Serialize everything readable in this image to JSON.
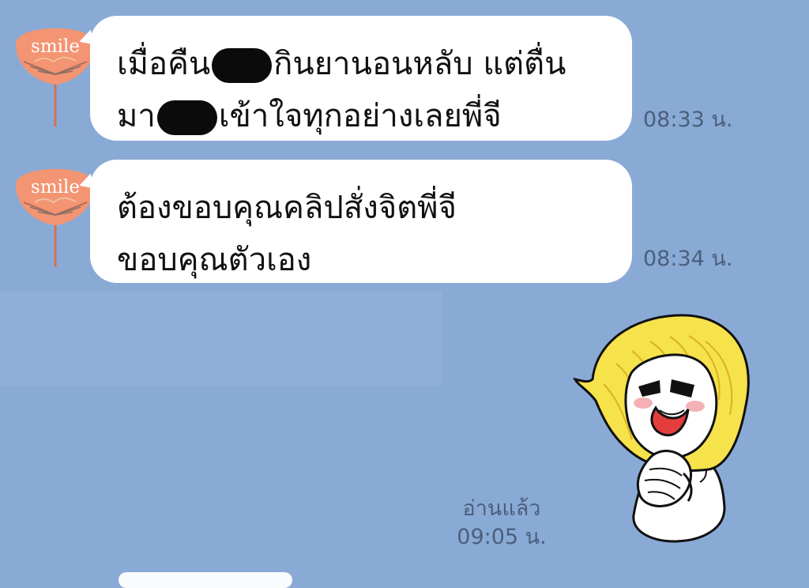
{
  "chat": {
    "messages": [
      {
        "sender_avatar_text": "smile",
        "lines": [
          {
            "before": "เมื่อคืน",
            "after": "กินยานอนหลับ แต่ตื่น"
          },
          {
            "before": "มา",
            "after": "เข้าใจทุกอย่างเลยพี่จี"
          }
        ],
        "time": "08:33 น."
      },
      {
        "sender_avatar_text": "smile",
        "lines": [
          {
            "text": "ต้องขอบคุณคลิปสั่งจิตพี่จี"
          },
          {
            "text": "ขอบคุณตัวเอง"
          }
        ],
        "time": "08:34 น."
      }
    ],
    "sent_sticker": {
      "icon": "praying-blonde-girl-sticker-icon",
      "read_label": "อ่านแล้ว",
      "time": "09:05 น."
    }
  },
  "colors": {
    "background": "#8aaad6",
    "bubble": "#ffffff",
    "avatar_orange": "#f39472",
    "sticker_hair": "#f6e24b",
    "meta_text": "#4b5f7b"
  }
}
